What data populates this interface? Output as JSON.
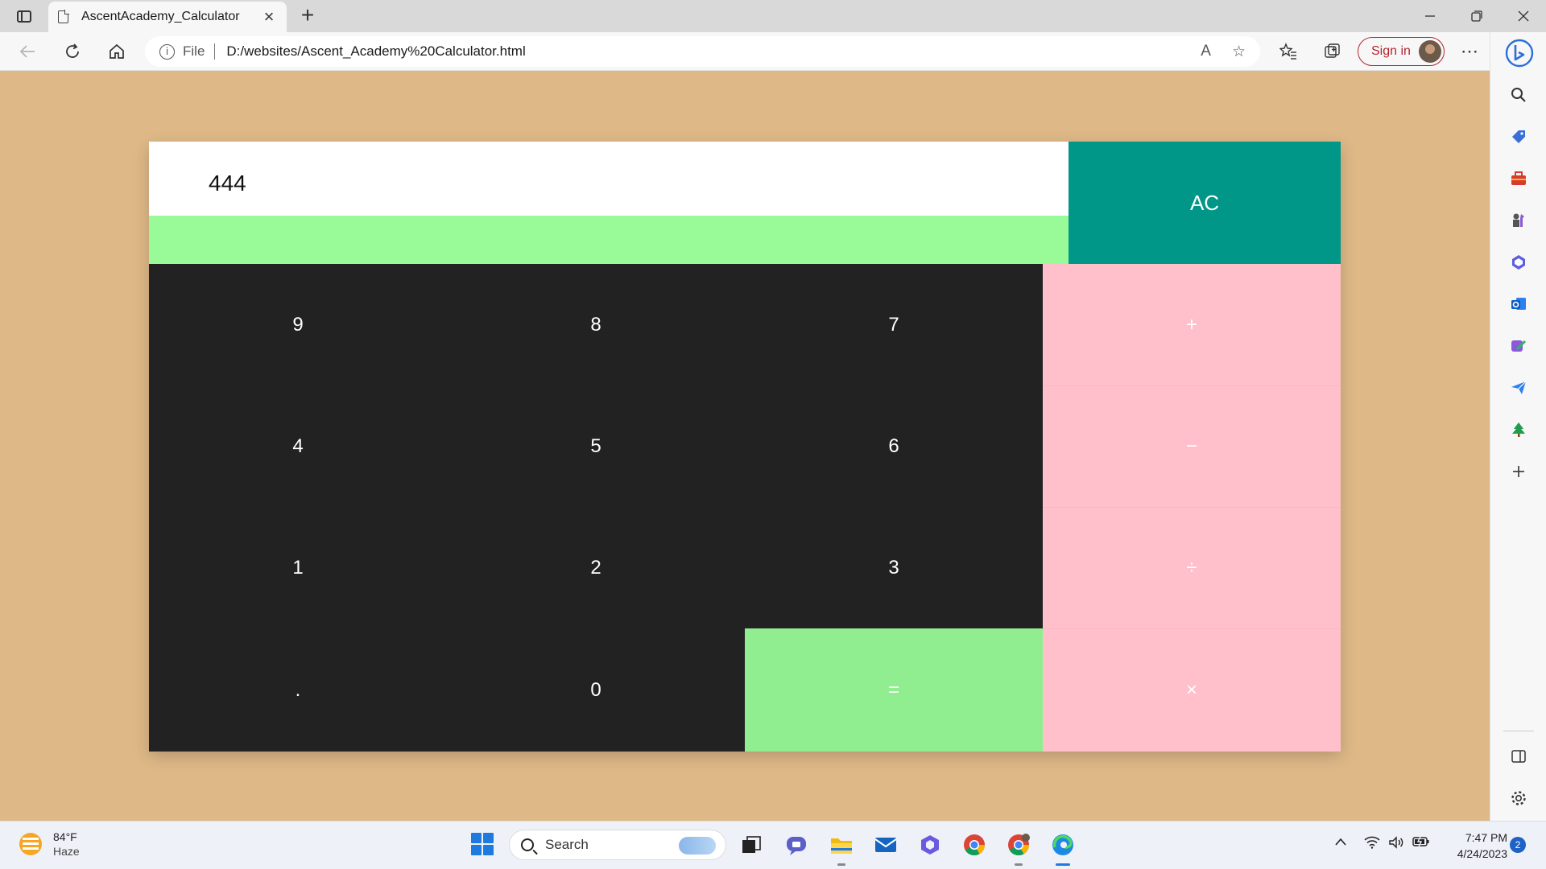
{
  "browser": {
    "tab_title": "AscentAcademy_Calculator",
    "address_scheme": "File",
    "address_url": "D:/websites/Ascent_Academy%20Calculator.html",
    "signin_label": "Sign in",
    "new_tab_label": "+",
    "tab_close_label": "×"
  },
  "calculator": {
    "display_value": "444",
    "clear_label": "AC",
    "digits": {
      "nine": "9",
      "eight": "8",
      "seven": "7",
      "four": "4",
      "five": "5",
      "six": "6",
      "one": "1",
      "two": "2",
      "three": "3",
      "dot": ".",
      "zero": "0"
    },
    "operators": {
      "add": "+",
      "subtract": "−",
      "divide": "÷",
      "multiply": "×",
      "equals": "="
    },
    "colors": {
      "page_background": "#deb887",
      "display_bar": "#98fb98",
      "clear_button": "#009688",
      "digit_keys": "#222222",
      "operator_keys": "#ffc0cb",
      "equals_key": "#90ee90"
    }
  },
  "taskbar": {
    "weather_temp": "84°F",
    "weather_condition": "Haze",
    "search_placeholder": "Search",
    "time": "7:47 PM",
    "date": "4/24/2023",
    "notification_count": "2"
  }
}
